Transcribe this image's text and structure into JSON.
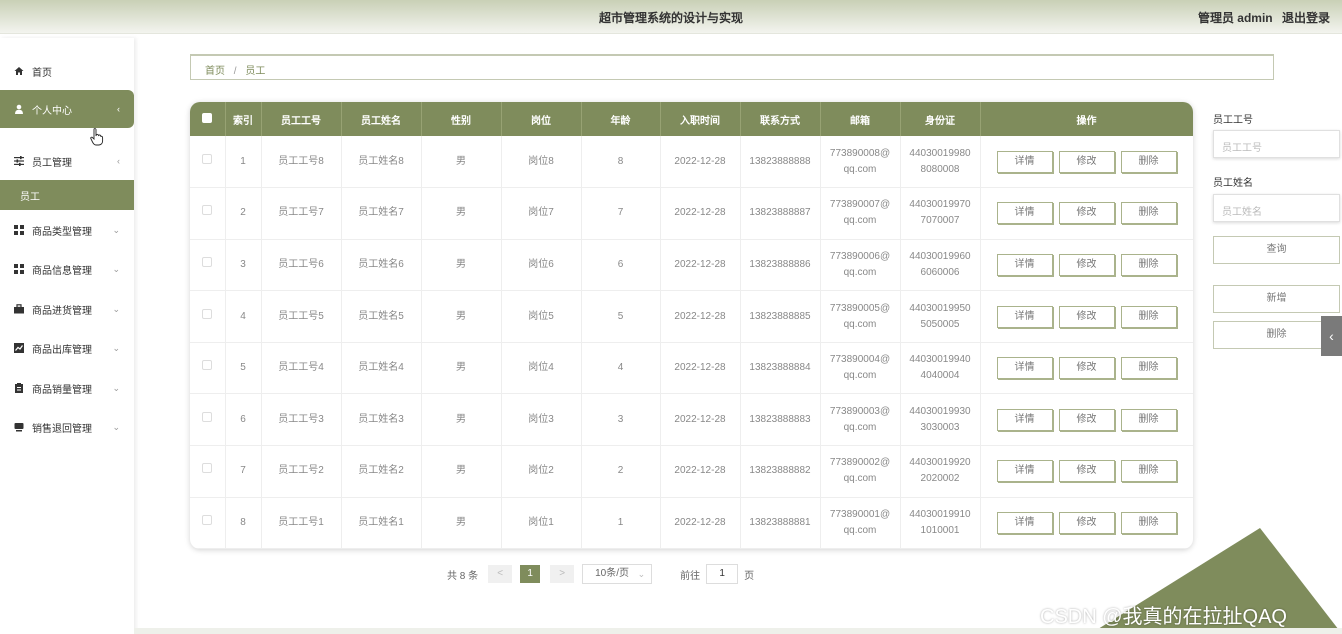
{
  "header": {
    "title": "超市管理系统的设计与实现",
    "user_label": "管理员 admin",
    "logout": "退出登录"
  },
  "sidebar": {
    "items": [
      {
        "label": "首页",
        "icon": "home-icon"
      },
      {
        "label": "个人中心",
        "icon": "user-icon"
      },
      {
        "label": "员工管理",
        "icon": "sliders-icon"
      },
      {
        "label": "员工",
        "icon": ""
      },
      {
        "label": "商品类型管理",
        "icon": "grid-icon"
      },
      {
        "label": "商品信息管理",
        "icon": "grid-icon"
      },
      {
        "label": "商品进货管理",
        "icon": "briefcase-icon"
      },
      {
        "label": "商品出库管理",
        "icon": "chart-icon"
      },
      {
        "label": "商品销量管理",
        "icon": "clipboard-icon"
      },
      {
        "label": "销售退回管理",
        "icon": "monitor-icon"
      }
    ]
  },
  "breadcrumb": {
    "home": "首页",
    "sep": "/",
    "current": "员工"
  },
  "table": {
    "headers": [
      "索引",
      "员工工号",
      "员工姓名",
      "性别",
      "岗位",
      "年龄",
      "入职时间",
      "联系方式",
      "邮箱",
      "身份证",
      "操作"
    ],
    "actions": {
      "detail": "详情",
      "edit": "修改",
      "delete": "删除"
    },
    "rows": [
      {
        "index": "1",
        "id": "员工工号8",
        "name": "员工姓名8",
        "gender": "男",
        "post": "岗位8",
        "age": "8",
        "date": "2022-12-28",
        "phone": "13823888888",
        "email1": "773890008@",
        "email2": "qq.com",
        "idcard1": "44030019980",
        "idcard2": "8080008"
      },
      {
        "index": "2",
        "id": "员工工号7",
        "name": "员工姓名7",
        "gender": "男",
        "post": "岗位7",
        "age": "7",
        "date": "2022-12-28",
        "phone": "13823888887",
        "email1": "773890007@",
        "email2": "qq.com",
        "idcard1": "44030019970",
        "idcard2": "7070007"
      },
      {
        "index": "3",
        "id": "员工工号6",
        "name": "员工姓名6",
        "gender": "男",
        "post": "岗位6",
        "age": "6",
        "date": "2022-12-28",
        "phone": "13823888886",
        "email1": "773890006@",
        "email2": "qq.com",
        "idcard1": "44030019960",
        "idcard2": "6060006"
      },
      {
        "index": "4",
        "id": "员工工号5",
        "name": "员工姓名5",
        "gender": "男",
        "post": "岗位5",
        "age": "5",
        "date": "2022-12-28",
        "phone": "13823888885",
        "email1": "773890005@",
        "email2": "qq.com",
        "idcard1": "44030019950",
        "idcard2": "5050005"
      },
      {
        "index": "5",
        "id": "员工工号4",
        "name": "员工姓名4",
        "gender": "男",
        "post": "岗位4",
        "age": "4",
        "date": "2022-12-28",
        "phone": "13823888884",
        "email1": "773890004@",
        "email2": "qq.com",
        "idcard1": "44030019940",
        "idcard2": "4040004"
      },
      {
        "index": "6",
        "id": "员工工号3",
        "name": "员工姓名3",
        "gender": "男",
        "post": "岗位3",
        "age": "3",
        "date": "2022-12-28",
        "phone": "13823888883",
        "email1": "773890003@",
        "email2": "qq.com",
        "idcard1": "44030019930",
        "idcard2": "3030003"
      },
      {
        "index": "7",
        "id": "员工工号2",
        "name": "员工姓名2",
        "gender": "男",
        "post": "岗位2",
        "age": "2",
        "date": "2022-12-28",
        "phone": "13823888882",
        "email1": "773890002@",
        "email2": "qq.com",
        "idcard1": "44030019920",
        "idcard2": "2020002"
      },
      {
        "index": "8",
        "id": "员工工号1",
        "name": "员工姓名1",
        "gender": "男",
        "post": "岗位1",
        "age": "1",
        "date": "2022-12-28",
        "phone": "13823888881",
        "email1": "773890001@",
        "email2": "qq.com",
        "idcard1": "44030019910",
        "idcard2": "1010001"
      }
    ]
  },
  "pagination": {
    "total": "共 8 条",
    "prev": "<",
    "current": "1",
    "next": ">",
    "page_size": "10条/页",
    "goto_label": "前往",
    "goto_value": "1",
    "page_suffix": "页"
  },
  "search": {
    "id_label": "员工工号",
    "id_placeholder": "员工工号",
    "name_label": "员工姓名",
    "name_placeholder": "员工姓名",
    "query_button": "查询",
    "add_button": "新增",
    "delete_button": "删除"
  },
  "watermark": "CSDN @我真的在拉扯QAQ",
  "colors": {
    "accent": "#7f8c5c",
    "header_gradient_top": "#c9d0b6"
  }
}
